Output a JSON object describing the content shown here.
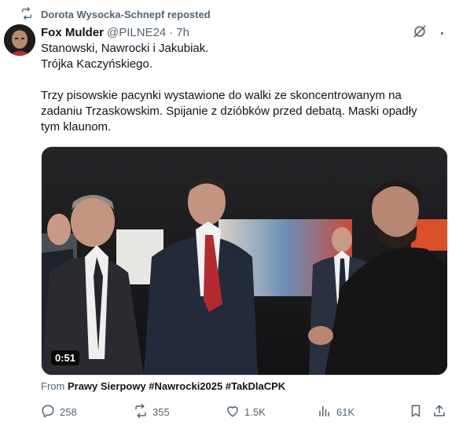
{
  "repost": {
    "label": "Dorota Wysocka-Schnepf reposted",
    "icon": "repost-icon"
  },
  "post": {
    "author_name": "Fox Mulder",
    "author_handle": "@PILNE24",
    "separator": "·",
    "time": "7h",
    "text_lines": [
      "Stanowski, Nawrocki i Jakubiak.",
      "Trójka Kaczyńskiego.",
      "Trzy pisowskie pacynki wystawione do walki ze skoncentrowanym na",
      "zadaniu Trzaskowskim. Spijanie z dzióbków przed debatą. Maski opadły",
      "tym klaunom."
    ],
    "video_duration": "0:51",
    "from_prefix": "From",
    "from_source": "Prawy Sierpowy #Nawrocki2025 #TakDlaCPK"
  },
  "actions": {
    "replies": "258",
    "reposts": "355",
    "likes": "1.5K",
    "views": "61K"
  },
  "icons": [
    "repost-icon",
    "grok-icon",
    "more-icon",
    "reply-icon",
    "retweet-icon",
    "like-icon",
    "views-icon",
    "bookmark-icon",
    "share-icon"
  ],
  "colors": {
    "text": "#0f1419",
    "secondary": "#536471",
    "background": "#ffffff"
  }
}
